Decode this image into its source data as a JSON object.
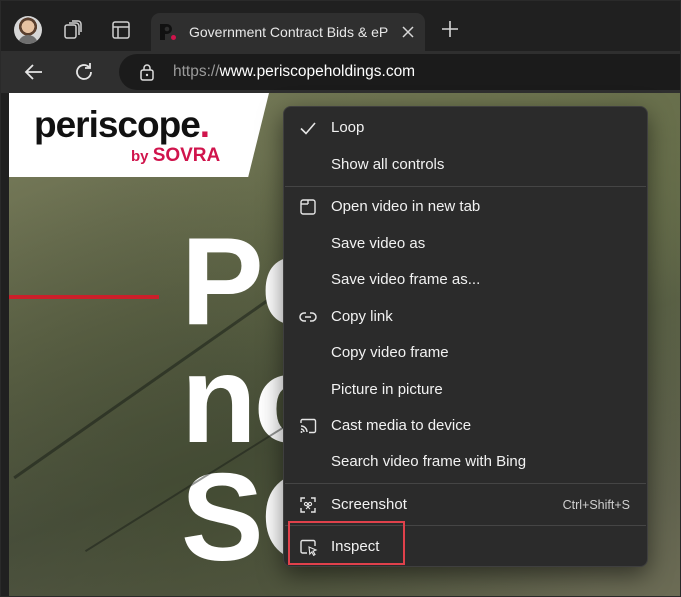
{
  "browser": {
    "tab": {
      "title": "Government Contract Bids & eProcurement Solutions | Periscope by SOVRA"
    },
    "address_bar": {
      "scheme": "https://",
      "host": "www.periscopeholdings.com"
    }
  },
  "page": {
    "logo": {
      "wordmark": "periscope",
      "dot": ".",
      "by": "by",
      "brand": "SOVRA"
    },
    "hero_lines": [
      "Pe",
      "no",
      "SO"
    ]
  },
  "context_menu": {
    "items": [
      {
        "label": "Loop",
        "icon": "check-icon",
        "checked": true
      },
      {
        "label": "Show all controls",
        "icon": ""
      },
      {
        "label": "Open video in new tab",
        "icon": "new-tab-icon"
      },
      {
        "label": "Save video as",
        "icon": ""
      },
      {
        "label": "Save video frame as...",
        "icon": ""
      },
      {
        "label": "Copy link",
        "icon": "link-icon"
      },
      {
        "label": "Copy video frame",
        "icon": ""
      },
      {
        "label": "Picture in picture",
        "icon": ""
      },
      {
        "label": "Cast media to device",
        "icon": "cast-icon"
      },
      {
        "label": "Search video frame with Bing",
        "icon": ""
      },
      {
        "label": "Screenshot",
        "icon": "screenshot-icon",
        "shortcut": "Ctrl+Shift+S"
      },
      {
        "label": "Inspect",
        "icon": "inspect-icon",
        "highlighted": true
      }
    ]
  },
  "colors": {
    "brand_red": "#d0144c",
    "highlight_border": "#e0414b",
    "menu_bg": "#2b2b2b"
  }
}
